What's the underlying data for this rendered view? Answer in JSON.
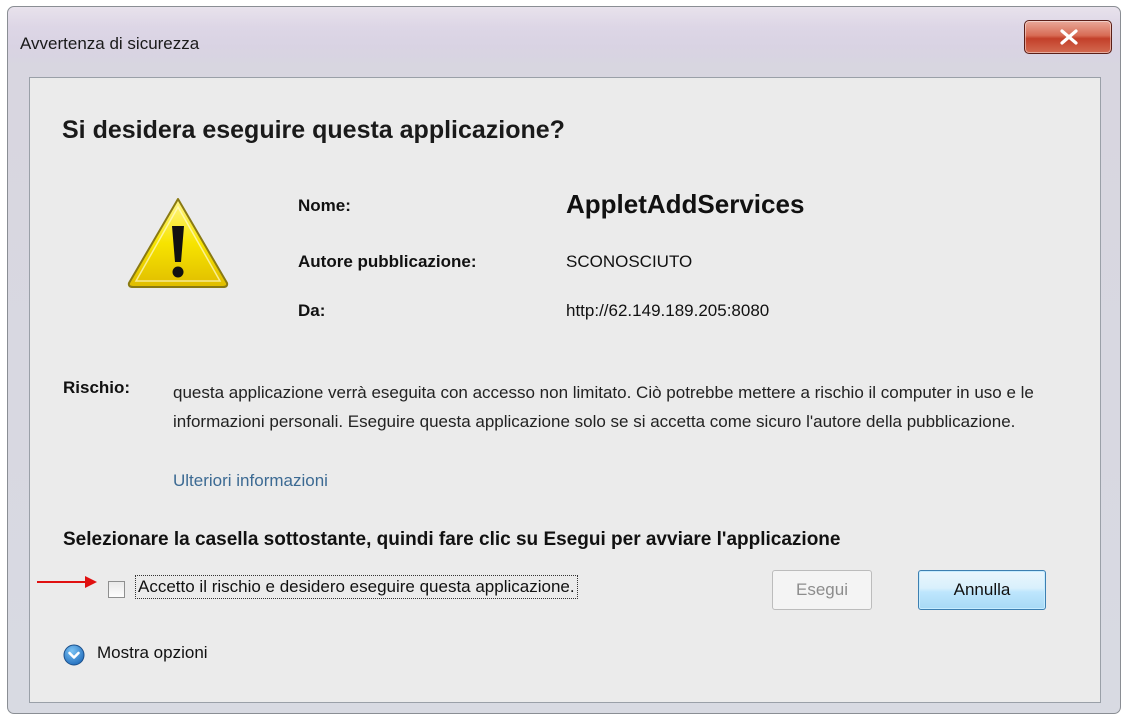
{
  "window": {
    "title": "Avvertenza di sicurezza"
  },
  "dialog": {
    "heading": "Si desidera eseguire questa applicazione?",
    "fields": {
      "name_label": "Nome:",
      "name_value": "AppletAddServices",
      "publisher_label": "Autore pubblicazione:",
      "publisher_value": "SCONOSCIUTO",
      "from_label": "Da:",
      "from_value": "http://62.149.189.205:8080"
    },
    "risk": {
      "label": "Rischio:",
      "text": "questa applicazione verrà eseguita con accesso non limitato. Ciò potrebbe mettere a rischio il computer in uso e le informazioni personali. Eseguire questa applicazione solo se si accetta come sicuro l'autore della pubblicazione.",
      "more_info_link": "Ulteriori informazioni"
    },
    "instruction": "Selezionare la casella sottostante, quindi fare clic su Esegui per avviare l'applicazione",
    "accept_checkbox": {
      "label": "Accetto il rischio e desidero eseguire questa applicazione.",
      "checked": false
    },
    "buttons": {
      "run": "Esegui",
      "cancel": "Annulla"
    },
    "show_options": "Mostra opzioni"
  },
  "icons": {
    "warning": "warning-triangle-icon",
    "close": "close-icon",
    "options": "chevron-down-circle-icon",
    "annotation": "red-arrow-icon"
  },
  "colors": {
    "link": "#3c6a93",
    "close_button": "#c3402a",
    "annotation_arrow": "#e01010",
    "warning_fill": "#f5e000"
  }
}
